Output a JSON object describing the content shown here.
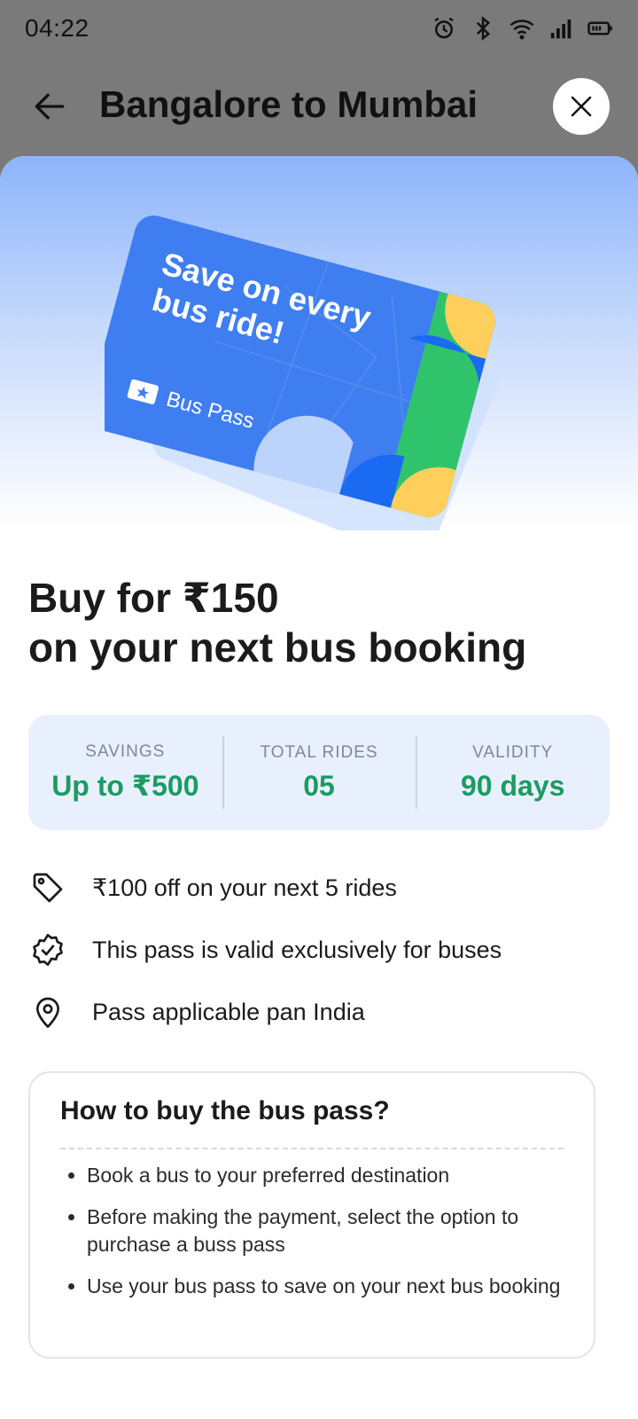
{
  "status_bar": {
    "time": "04:22"
  },
  "header": {
    "title": "Bangalore to Mumbai"
  },
  "card": {
    "headline_line1": "Save on every",
    "headline_line2": "bus ride!",
    "label": "Bus Pass"
  },
  "offer": {
    "line1": "Buy for ₹150",
    "line2": "on your next bus booking"
  },
  "stats": [
    {
      "label": "SAVINGS",
      "value": "Up to ₹500"
    },
    {
      "label": "TOTAL RIDES",
      "value": "05"
    },
    {
      "label": "VALIDITY",
      "value": "90 days"
    }
  ],
  "features": [
    {
      "icon": "tag-icon",
      "text": "₹100 off on your next 5 rides"
    },
    {
      "icon": "verified-badge-icon",
      "text": "This pass is valid exclusively for buses"
    },
    {
      "icon": "location-pin-icon",
      "text": "Pass applicable pan India"
    }
  ],
  "howto": {
    "title": "How to buy the bus pass?",
    "steps": [
      "Book a bus to your preferred destination",
      "Before making the payment, select the option to purchase a buss pass",
      "Use your bus pass to save on your next bus booking"
    ]
  },
  "colors": {
    "accent_green": "#1c9b63",
    "card_blue": "#3f7ef0",
    "stats_bg": "#e8f0fd"
  }
}
